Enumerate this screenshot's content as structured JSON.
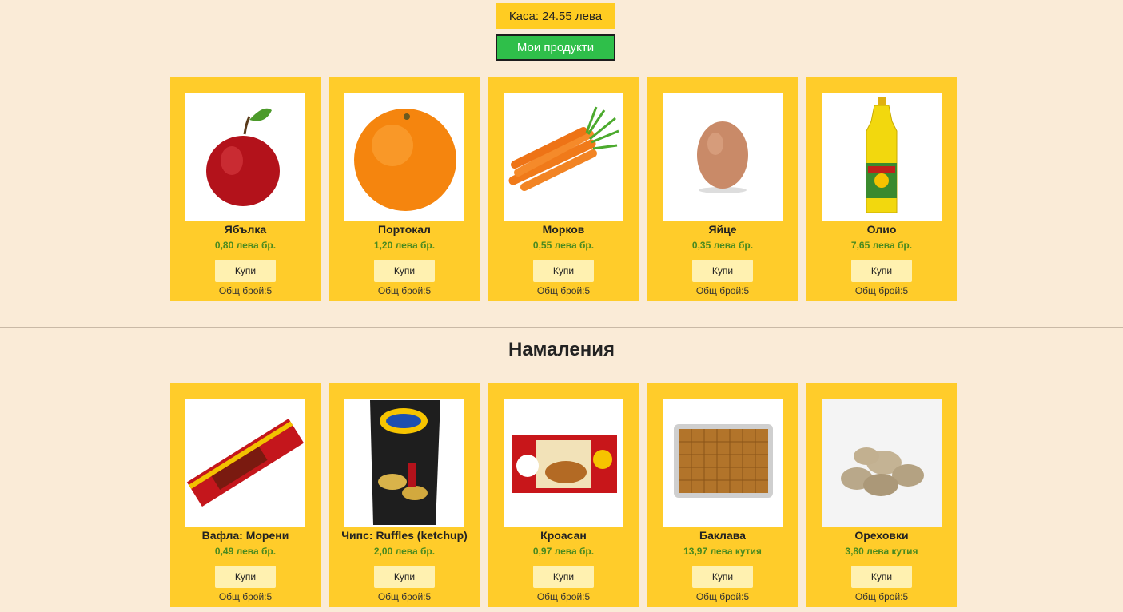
{
  "header": {
    "cash_label": "Каса: 24.55 лева",
    "my_products_label": "Мои продукти"
  },
  "colors": {
    "background": "#faebd7",
    "card": "#ffcc2a",
    "price_text": "#4a8a1f",
    "my_products_button": "#2fbf4a"
  },
  "products": [
    {
      "name": "Ябълка",
      "price": "0,80 лева бр.",
      "buy": "Купи",
      "count": "Общ брой:5",
      "image": "apple-image"
    },
    {
      "name": "Портокал",
      "price": "1,20 лева бр.",
      "buy": "Купи",
      "count": "Общ брой:5",
      "image": "orange-image"
    },
    {
      "name": "Морков",
      "price": "0,55 лева бр.",
      "buy": "Купи",
      "count": "Общ брой:5",
      "image": "carrot-image"
    },
    {
      "name": "Яйце",
      "price": "0,35 лева бр.",
      "buy": "Купи",
      "count": "Общ брой:5",
      "image": "egg-image"
    },
    {
      "name": "Олио",
      "price": "7,65 лева бр.",
      "buy": "Купи",
      "count": "Общ брой:5",
      "image": "oil-bottle-image"
    }
  ],
  "discounts": {
    "title": "Намаления",
    "items": [
      {
        "name": "Вафла: Морени",
        "price": "0,49 лева бр.",
        "buy": "Купи",
        "count": "Общ брой:5",
        "image": "wafer-image"
      },
      {
        "name": "Чипс: Ruffles (ketchup)",
        "price": "2,00 лева бр.",
        "buy": "Купи",
        "count": "Общ брой:5",
        "image": "chips-image"
      },
      {
        "name": "Кроасан",
        "price": "0,97 лева бр.",
        "buy": "Купи",
        "count": "Общ брой:5",
        "image": "croissant-image"
      },
      {
        "name": "Баклава",
        "price": "13,97 лева кутия",
        "buy": "Купи",
        "count": "Общ брой:5",
        "image": "baklava-image"
      },
      {
        "name": "Ореховки",
        "price": "3,80 лева кутия",
        "buy": "Купи",
        "count": "Общ брой:5",
        "image": "cookies-image"
      }
    ]
  }
}
